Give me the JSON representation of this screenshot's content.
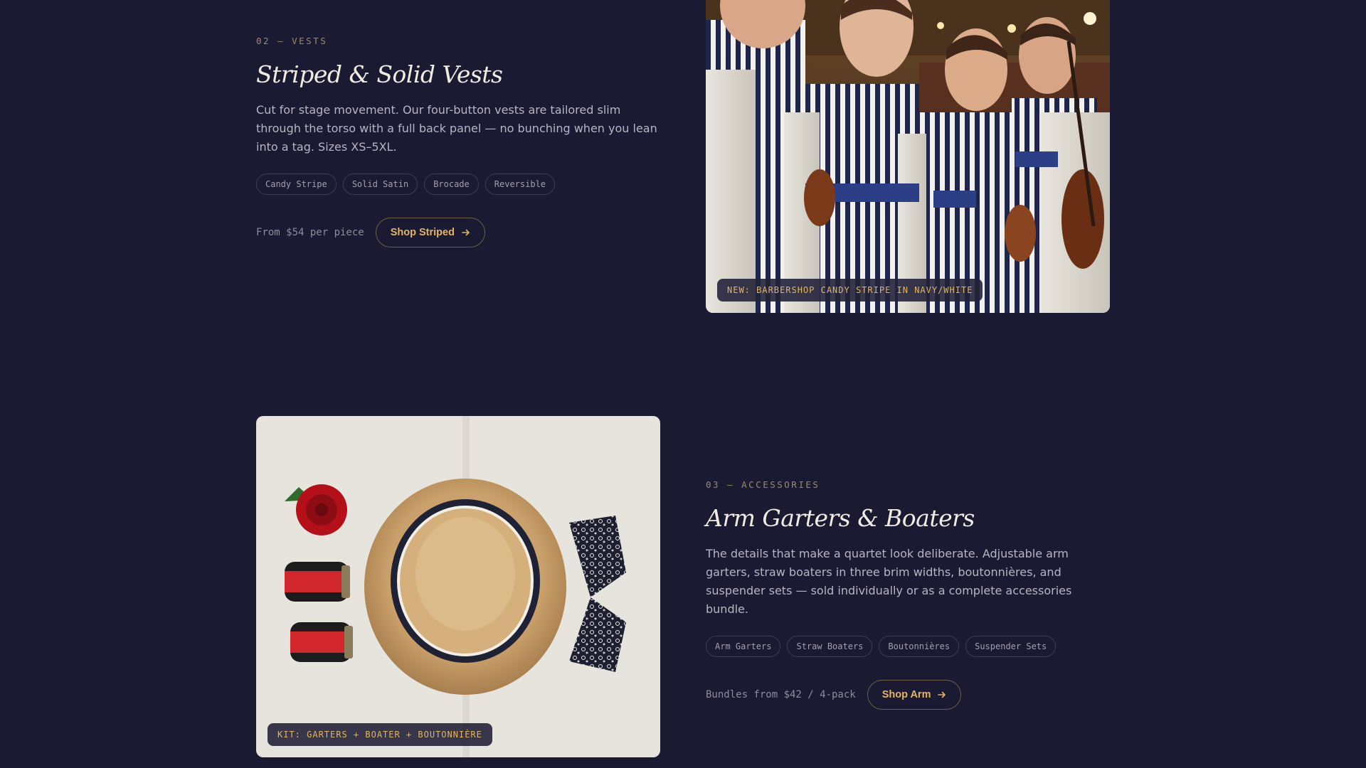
{
  "vests": {
    "eyebrow": "02 — VESTS",
    "title": "Striped & Solid Vests",
    "description": "Cut for stage movement. Our four-button vests are tailored slim through the torso with a full back panel — no bunching when you lean into a tag. Sizes XS–5XL.",
    "tags": [
      "Candy Stripe",
      "Solid Satin",
      "Brocade",
      "Reversible"
    ],
    "price": "From $54 per piece",
    "button_label": "Shop Striped",
    "image_caption": "NEW: BARBERSHOP CANDY STRIPE IN NAVY/WHITE"
  },
  "accessories": {
    "eyebrow": "03 — ACCESSORIES",
    "title": "Arm Garters & Boaters",
    "description": "The details that make a quartet look deliberate. Adjustable arm garters, straw boaters in three brim widths, boutonnières, and suspender sets — sold individually or as a complete accessories bundle.",
    "tags": [
      "Arm Garters",
      "Straw Boaters",
      "Boutonnières",
      "Suspender Sets"
    ],
    "price": "Bundles from $42 / 4-pack",
    "button_label": "Shop Arm",
    "image_caption": "KIT: GARTERS + BOATER + BOUTONNIÈRE"
  },
  "colors": {
    "background": "#1b1a33",
    "accent": "#e2b560",
    "eyebrow": "#9c8a66"
  }
}
